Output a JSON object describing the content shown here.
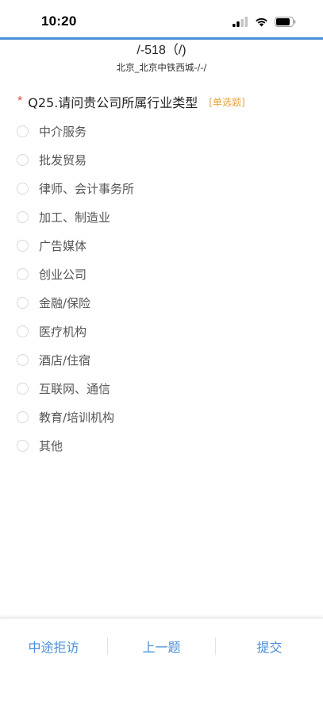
{
  "status": {
    "time": "10:20"
  },
  "header": {
    "title": "/-518（/)",
    "subtitle": "北京_北京中铁西城-/-/"
  },
  "question": {
    "required_mark": "*",
    "text": "Q25.请问贵公司所属行业类型",
    "type_label": "[单选题]"
  },
  "options": [
    {
      "label": "中介服务"
    },
    {
      "label": "批发贸易"
    },
    {
      "label": "律师、会计事务所"
    },
    {
      "label": "加工、制造业"
    },
    {
      "label": "广告媒体"
    },
    {
      "label": "创业公司"
    },
    {
      "label": "金融/保险"
    },
    {
      "label": "医疗机构"
    },
    {
      "label": "酒店/住宿"
    },
    {
      "label": "互联网、通信"
    },
    {
      "label": "教育/培训机构"
    },
    {
      "label": "其他"
    }
  ],
  "toolbar": {
    "refuse_label": "中途拒访",
    "prev_label": "上一题",
    "submit_label": "提交"
  },
  "colors": {
    "accent": "#4a90d9",
    "required": "#e0473c",
    "question_type": "#e8a33d"
  }
}
